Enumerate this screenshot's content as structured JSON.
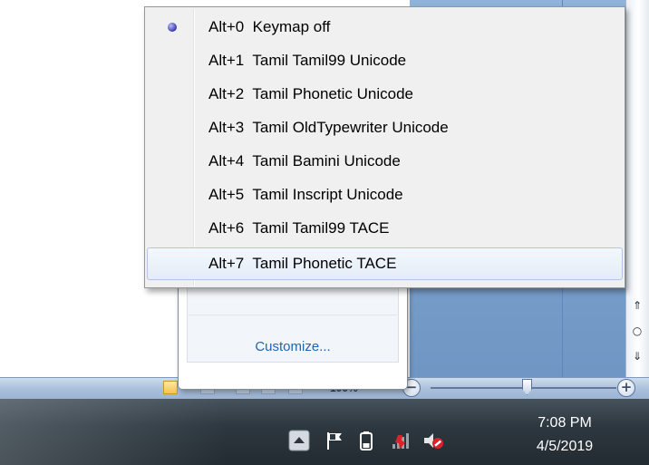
{
  "keymap_menu": {
    "items": [
      {
        "shortcut": "Alt+0",
        "name": "Keymap off",
        "text": "Alt+0  Keymap off",
        "selected": true
      },
      {
        "shortcut": "Alt+1",
        "name": "Tamil Tamil99 Unicode",
        "text": "Alt+1  Tamil Tamil99 Unicode"
      },
      {
        "shortcut": "Alt+2",
        "name": "Tamil Phonetic Unicode",
        "text": "Alt+2  Tamil Phonetic Unicode"
      },
      {
        "shortcut": "Alt+3",
        "name": "Tamil OldTypewriter Unicode",
        "text": "Alt+3  Tamil OldTypewriter Unicode"
      },
      {
        "shortcut": "Alt+4",
        "name": "Tamil Bamini Unicode",
        "text": "Alt+4  Tamil Bamini Unicode"
      },
      {
        "shortcut": "Alt+5",
        "name": "Tamil Inscript Unicode",
        "text": "Alt+5  Tamil Inscript Unicode"
      },
      {
        "shortcut": "Alt+6",
        "name": "Tamil Tamil99 TACE",
        "text": "Alt+6  Tamil Tamil99 TACE"
      },
      {
        "shortcut": "Alt+7",
        "name": "Tamil Phonetic TACE",
        "text": "Alt+7  Tamil Phonetic TACE",
        "hovered": true
      }
    ]
  },
  "tray_popup": {
    "customize_label": "Customize..."
  },
  "status_bar": {
    "zoom_level": "100%"
  },
  "taskbar": {
    "clock_time": "7:08 PM",
    "clock_date": "4/5/2019",
    "tray_icons": [
      "show-hidden-icons-arrow-icon",
      "action-center-flag-icon",
      "battery-icon",
      "network-icon",
      "volume-muted-icon"
    ]
  },
  "colors": {
    "menu_background": "#f0f0f0",
    "hover_highlight": "#e3ecf7",
    "taskbar": "#2e3840",
    "link": "#1f65b5",
    "app_background_blue": "#7aa1cc"
  }
}
